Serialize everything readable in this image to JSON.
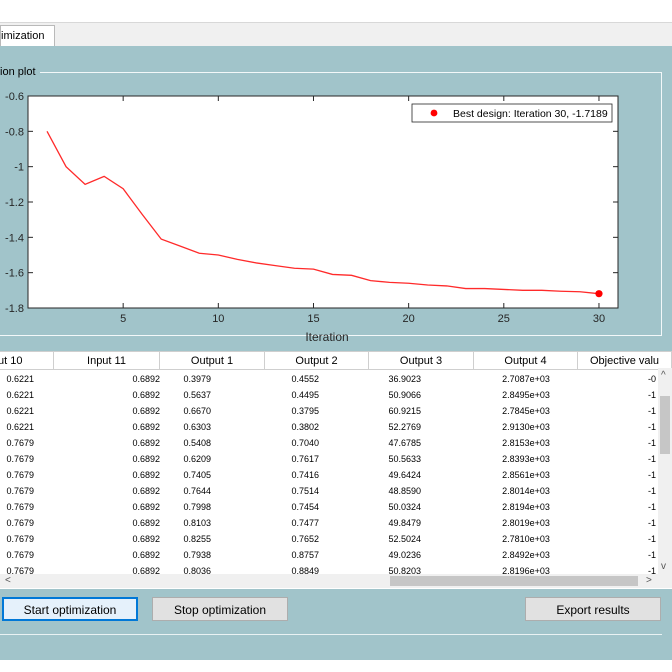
{
  "tab": {
    "label": "timization"
  },
  "group": {
    "title": "tion plot"
  },
  "chart_data": {
    "type": "line",
    "xlabel": "Iteration",
    "ylabel": "",
    "xlim": [
      0,
      31
    ],
    "ylim": [
      -1.8,
      -0.6
    ],
    "xticks": [
      5,
      10,
      15,
      20,
      25,
      30
    ],
    "yticks": [
      -0.6,
      -0.8,
      -1,
      -1.2,
      -1.4,
      -1.6,
      -1.8
    ],
    "x": [
      1,
      2,
      3,
      4,
      5,
      6,
      7,
      8,
      9,
      10,
      11,
      12,
      13,
      14,
      15,
      16,
      17,
      18,
      19,
      20,
      21,
      22,
      23,
      24,
      25,
      26,
      27,
      28,
      29,
      30
    ],
    "y": [
      -0.8,
      -1.0,
      -1.1,
      -1.055,
      -1.125,
      -1.27,
      -1.41,
      -1.45,
      -1.49,
      -1.5,
      -1.525,
      -1.545,
      -1.56,
      -1.575,
      -1.58,
      -1.61,
      -1.615,
      -1.645,
      -1.655,
      -1.66,
      -1.67,
      -1.675,
      -1.69,
      -1.69,
      -1.695,
      -1.7,
      -1.7,
      -1.705,
      -1.708,
      -1.7189
    ],
    "line_color": "#ff2a2a",
    "best": {
      "x": 30,
      "y": -1.7189,
      "color": "#ff0000"
    },
    "legend": {
      "text": "Best design: Iteration 30, -1.7189",
      "placement": "top-right"
    },
    "grid": false
  },
  "table": {
    "columns": [
      "ut 10",
      "Input 11",
      "Output 1",
      "Output 2",
      "Output 3",
      "Output 4",
      "Objective valu"
    ],
    "rows": [
      [
        "0.6221",
        "0.6892",
        "0.3979",
        "0.4552",
        "36.9023",
        "2.7087e+03",
        "-0"
      ],
      [
        "0.6221",
        "0.6892",
        "0.5637",
        "0.4495",
        "50.9066",
        "2.8495e+03",
        "-1"
      ],
      [
        "0.6221",
        "0.6892",
        "0.6670",
        "0.3795",
        "60.9215",
        "2.7845e+03",
        "-1"
      ],
      [
        "0.6221",
        "0.6892",
        "0.6303",
        "0.3802",
        "52.2769",
        "2.9130e+03",
        "-1"
      ],
      [
        "0.7679",
        "0.6892",
        "0.5408",
        "0.7040",
        "47.6785",
        "2.8153e+03",
        "-1"
      ],
      [
        "0.7679",
        "0.6892",
        "0.6209",
        "0.7617",
        "50.5633",
        "2.8393e+03",
        "-1"
      ],
      [
        "0.7679",
        "0.6892",
        "0.7405",
        "0.7416",
        "49.6424",
        "2.8561e+03",
        "-1"
      ],
      [
        "0.7679",
        "0.6892",
        "0.7644",
        "0.7514",
        "48.8590",
        "2.8014e+03",
        "-1"
      ],
      [
        "0.7679",
        "0.6892",
        "0.7998",
        "0.7454",
        "50.0324",
        "2.8194e+03",
        "-1"
      ],
      [
        "0.7679",
        "0.6892",
        "0.8103",
        "0.7477",
        "49.8479",
        "2.8019e+03",
        "-1"
      ],
      [
        "0.7679",
        "0.6892",
        "0.8255",
        "0.7652",
        "52.5024",
        "2.7810e+03",
        "-1"
      ],
      [
        "0.7679",
        "0.6892",
        "0.7938",
        "0.8757",
        "49.0236",
        "2.8492e+03",
        "-1"
      ],
      [
        "0.7679",
        "0.6892",
        "0.8036",
        "0.8849",
        "50.8203",
        "2.8196e+03",
        "-1"
      ]
    ]
  },
  "scroll": {
    "up": "^",
    "down": "v",
    "left": "<",
    "right": ">"
  },
  "buttons": {
    "start": "Start optimization",
    "stop": "Stop optimization",
    "export": "Export results"
  }
}
